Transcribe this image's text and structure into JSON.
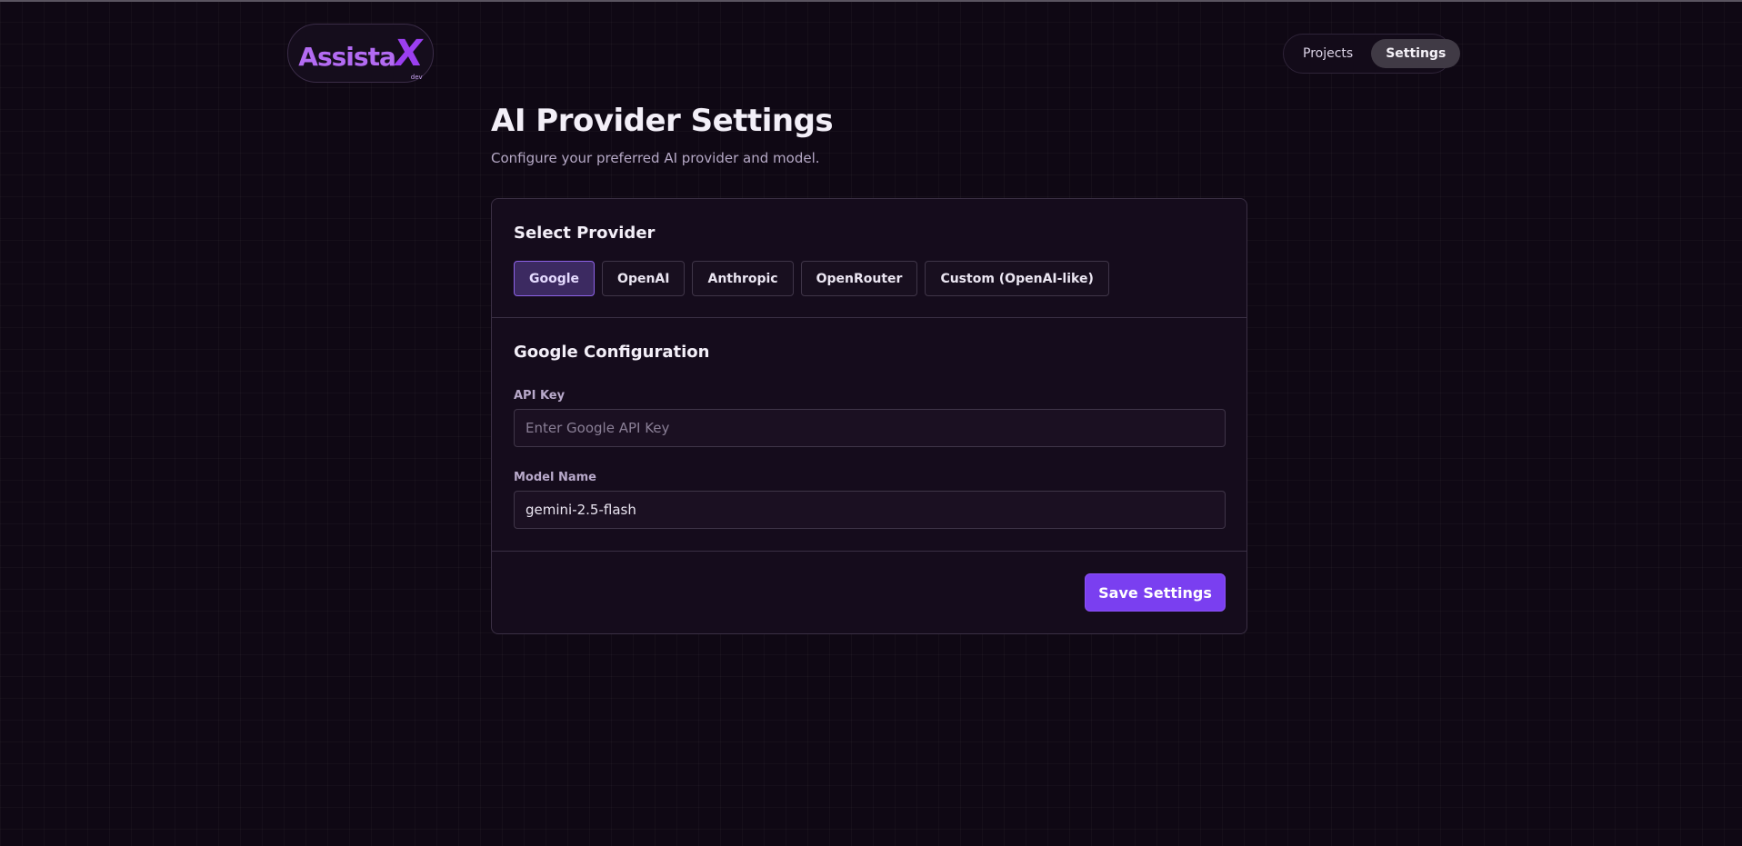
{
  "brand": {
    "name": "Assista",
    "mark": "X",
    "tag": "dev",
    "accent": "#9b3ff0"
  },
  "nav": {
    "items": [
      {
        "label": "Projects",
        "active": false
      },
      {
        "label": "Settings",
        "active": true
      }
    ]
  },
  "page": {
    "title": "AI Provider Settings",
    "subtitle": "Configure your preferred AI provider and model."
  },
  "provider_section": {
    "title": "Select Provider",
    "providers": [
      "Google",
      "OpenAI",
      "Anthropic",
      "OpenRouter",
      "Custom (OpenAI-like)"
    ],
    "selected": "Google"
  },
  "config_section": {
    "title": "Google Configuration",
    "api_key": {
      "label": "API Key",
      "placeholder": "Enter Google API Key",
      "value": ""
    },
    "model_name": {
      "label": "Model Name",
      "value": "gemini-2.5-flash"
    }
  },
  "actions": {
    "save_label": "Save Settings",
    "save_color": "#7a3ff0"
  }
}
